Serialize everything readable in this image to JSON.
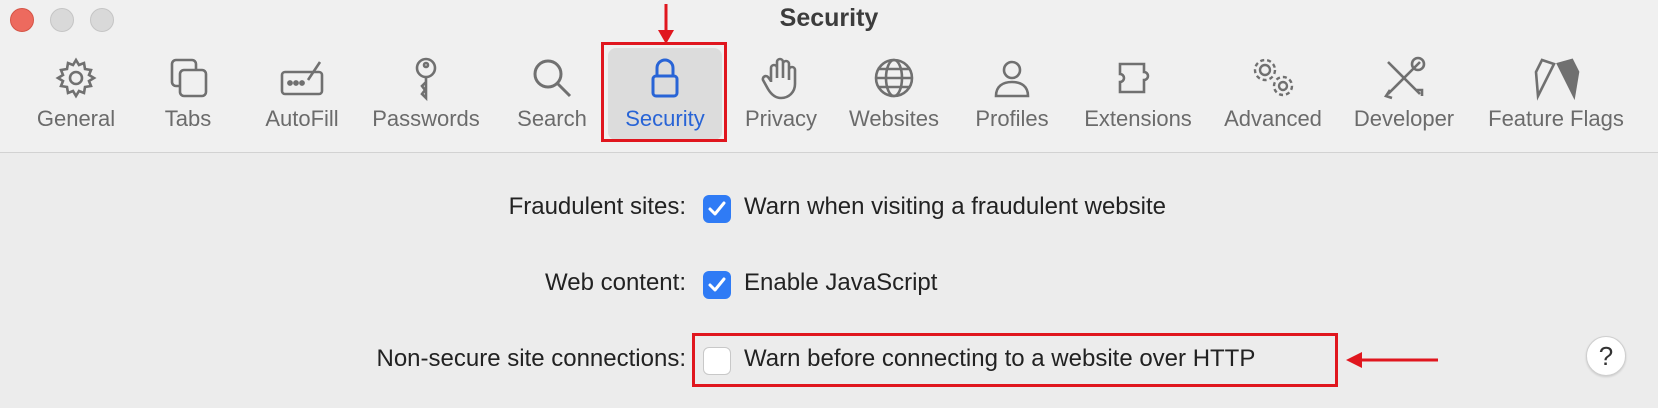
{
  "window": {
    "title": "Security"
  },
  "toolbar": {
    "items": [
      {
        "label": "General",
        "icon": "gear-icon"
      },
      {
        "label": "Tabs",
        "icon": "tabs-icon"
      },
      {
        "label": "AutoFill",
        "icon": "autofill-icon"
      },
      {
        "label": "Passwords",
        "icon": "key-icon"
      },
      {
        "label": "Search",
        "icon": "search-icon"
      },
      {
        "label": "Security",
        "icon": "lock-icon",
        "selected": true
      },
      {
        "label": "Privacy",
        "icon": "hand-icon"
      },
      {
        "label": "Websites",
        "icon": "globe-icon"
      },
      {
        "label": "Profiles",
        "icon": "person-icon"
      },
      {
        "label": "Extensions",
        "icon": "puzzle-icon"
      },
      {
        "label": "Advanced",
        "icon": "gears-icon"
      },
      {
        "label": "Developer",
        "icon": "tools-icon"
      },
      {
        "label": "Feature Flags",
        "icon": "flags-icon"
      }
    ]
  },
  "settings": {
    "fraudulent": {
      "label": "Fraudulent sites:",
      "text": "Warn when visiting a fraudulent website",
      "checked": true
    },
    "web_content": {
      "label": "Web content:",
      "text": "Enable JavaScript",
      "checked": true
    },
    "non_secure": {
      "label": "Non-secure site connections:",
      "text": "Warn before connecting to a website over HTTP",
      "checked": false
    }
  },
  "help": {
    "label": "?"
  },
  "colors": {
    "accent": "#2f7bf5",
    "annotation": "#e0161e",
    "selected_label": "#2864d6"
  }
}
